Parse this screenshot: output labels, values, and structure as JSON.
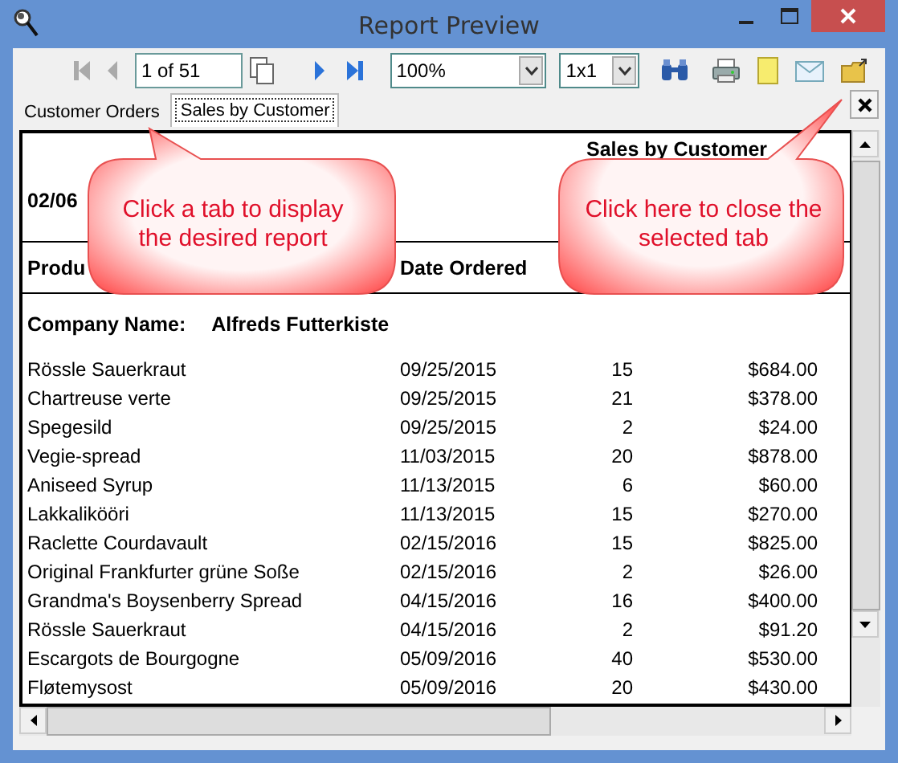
{
  "window": {
    "title": "Report Preview"
  },
  "toolbar": {
    "page": "1 of 51",
    "zoom": "100%",
    "layout": "1x1"
  },
  "tabs": [
    {
      "label": "Customer Orders",
      "selected": false
    },
    {
      "label": "Sales by Customer",
      "selected": true
    }
  ],
  "report": {
    "title": "Sales by Customer",
    "date": "02/06",
    "columns": [
      "Produ",
      "Date Ordered"
    ],
    "company_label": "Company Name:",
    "company": "Alfreds Futterkiste",
    "rows": [
      {
        "product": "Rössle Sauerkraut",
        "date": "09/25/2015",
        "quantity": "15",
        "amount": "$684.00"
      },
      {
        "product": "Chartreuse verte",
        "date": "09/25/2015",
        "quantity": "21",
        "amount": "$378.00"
      },
      {
        "product": "Spegesild",
        "date": "09/25/2015",
        "quantity": "2",
        "amount": "$24.00"
      },
      {
        "product": "Vegie-spread",
        "date": "11/03/2015",
        "quantity": "20",
        "amount": "$878.00"
      },
      {
        "product": "Aniseed Syrup",
        "date": "11/13/2015",
        "quantity": "6",
        "amount": "$60.00"
      },
      {
        "product": "Lakkalikööri",
        "date": "11/13/2015",
        "quantity": "15",
        "amount": "$270.00"
      },
      {
        "product": "Raclette Courdavault",
        "date": "02/15/2016",
        "quantity": "15",
        "amount": "$825.00"
      },
      {
        "product": "Original Frankfurter grüne Soße",
        "date": "02/15/2016",
        "quantity": "2",
        "amount": "$26.00"
      },
      {
        "product": "Grandma's Boysenberry Spread",
        "date": "04/15/2016",
        "quantity": "16",
        "amount": "$400.00"
      },
      {
        "product": "Rössle Sauerkraut",
        "date": "04/15/2016",
        "quantity": "2",
        "amount": "$91.20"
      },
      {
        "product": "Escargots de Bourgogne",
        "date": "05/09/2016",
        "quantity": "40",
        "amount": "$530.00"
      },
      {
        "product": "Fløtemysost",
        "date": "05/09/2016",
        "quantity": "20",
        "amount": "$430.00"
      }
    ]
  },
  "callouts": [
    {
      "text": "Click a tab to display the desired report"
    },
    {
      "text": "Click here to close the selected tab"
    }
  ]
}
